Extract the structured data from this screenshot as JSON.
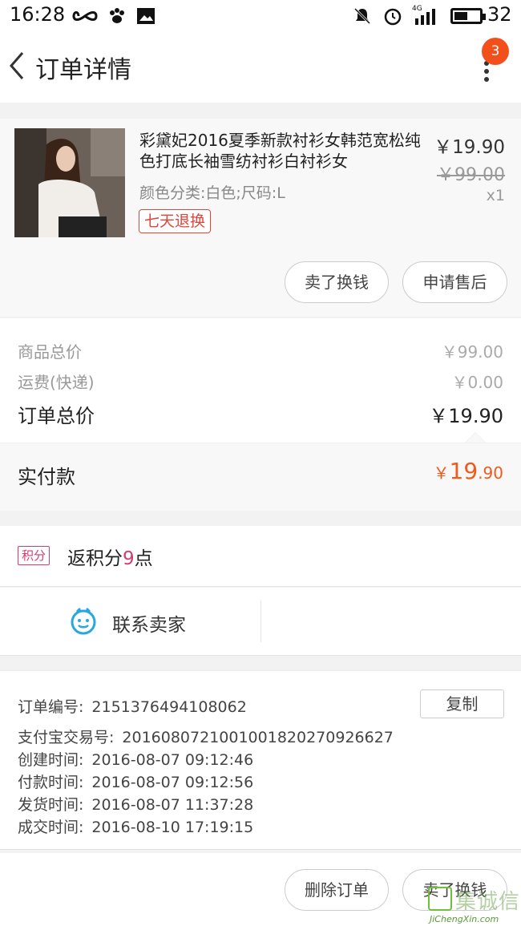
{
  "status_bar": {
    "time": "16:28",
    "network": "4G",
    "battery": "32",
    "icons": [
      "infinity-icon",
      "paw-icon",
      "image-icon",
      "mute-icon",
      "alarm-icon",
      "signal-icon",
      "battery-icon"
    ]
  },
  "header": {
    "title": "订单详情",
    "badge_count": "3"
  },
  "product": {
    "title": "彩黛妃2016夏季新款衬衫女韩范宽松纯色打底长袖雪纺衬衫白衬衫女",
    "sku": "颜色分类:白色;尺码:L",
    "tag": "七天退换",
    "price": "￥19.90",
    "original_price": "￥99.00",
    "quantity": "x1",
    "buttons": [
      "卖了换钱",
      "申请售后"
    ]
  },
  "totals": {
    "goods_label": "商品总价",
    "goods_value": "￥99.00",
    "shipping_label": "运费(快递)",
    "shipping_value": "￥0.00",
    "order_label": "订单总价",
    "order_value": "￥19.90",
    "paid_label": "实付款",
    "paid_currency": "￥",
    "paid_int": "19",
    "paid_dec": ".90"
  },
  "points": {
    "tag": "积分",
    "prefix": "返积分",
    "value": "9",
    "suffix": "点"
  },
  "contact": {
    "label": "联系卖家"
  },
  "order_info": {
    "rows": [
      {
        "key": "订单编号:",
        "value": "2151376494108062"
      },
      {
        "key": "支付宝交易号:",
        "value": "2016080721001001820270926627"
      },
      {
        "key": "创建时间:",
        "value": "2016-08-07 09:12:46"
      },
      {
        "key": "付款时间:",
        "value": "2016-08-07 09:12:56"
      },
      {
        "key": "发货时间:",
        "value": "2016-08-07 11:37:28"
      },
      {
        "key": "成交时间:",
        "value": "2016-08-10 17:19:15"
      }
    ],
    "copy_label": "复制"
  },
  "bottom": {
    "delete_label": "删除订单",
    "sell_label": "卖了换钱"
  },
  "watermark": {
    "text": "集诚信",
    "url": "JiChengXin.com"
  },
  "colors": {
    "accent": "#f05a1a",
    "badge": "#f24f1b",
    "points": "#d23c6f",
    "tag": "#e0453a",
    "contact_icon": "#28a8e0"
  }
}
